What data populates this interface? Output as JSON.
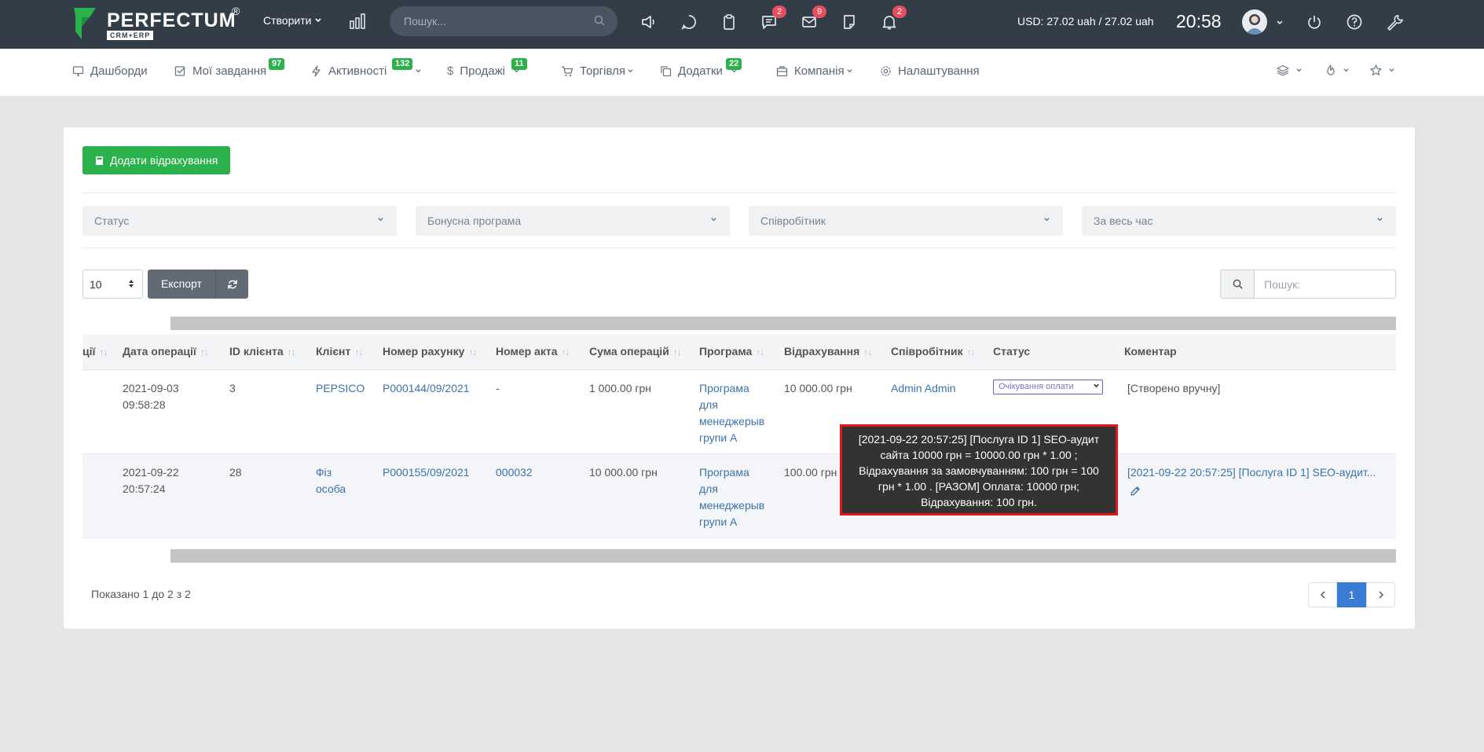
{
  "brand": {
    "name": "PERFECTUM",
    "sub": "CRM+ERP",
    "reg": "®"
  },
  "topbar": {
    "create_label": "Створити",
    "search_placeholder": "Пошук...",
    "badges": {
      "chat": "2",
      "mail": "9",
      "notifications": "2"
    },
    "currency": "USD: 27.02 uah / 27.02 uah",
    "time": "20:58"
  },
  "nav": {
    "items": [
      {
        "label": "Дашборди"
      },
      {
        "label": "Мої завдання",
        "badge": "97"
      },
      {
        "label": "Активності",
        "badge": "132"
      },
      {
        "label": "Продажі",
        "badge": "11"
      },
      {
        "label": "Торгівля"
      },
      {
        "label": "Додатки",
        "badge": "22"
      },
      {
        "label": "Компанія"
      },
      {
        "label": "Налаштування"
      }
    ]
  },
  "page": {
    "add_button": "Додати відрахування",
    "filters": [
      "Статус",
      "Бонусна програма",
      "Співробітник",
      "За весь час"
    ],
    "page_length": "10",
    "export_label": "Експорт",
    "search_placeholder": "Пошук:"
  },
  "table": {
    "columns": [
      "ції",
      "Дата операції",
      "ID клієнта",
      "Клієнт",
      "Номер рахунку",
      "Номер акта",
      "Сума операцій",
      "Програма",
      "Відрахування",
      "Співробітник",
      "Статус",
      "Коментар"
    ],
    "rows": [
      {
        "date1": "2021-09-03",
        "date2": "09:58:28",
        "client_id": "3",
        "client": "PEPSICO",
        "invoice": "P000144/09/2021",
        "act": "-",
        "amount": "1 000.00 грн",
        "program": [
          "Програма",
          "для",
          "менеджерыв",
          "групи А"
        ],
        "deduction": "10 000.00 грн",
        "employee": "Admin Admin",
        "status": "Очікування оплати",
        "comment": "[Створено вручну]"
      },
      {
        "date1": "2021-09-22",
        "date2": "20:57:24",
        "client_id": "28",
        "client": "Фіз особа",
        "invoice": "P000155/09/2021",
        "act": "000032",
        "amount": "10 000.00 грн",
        "program": [
          "Програма",
          "для",
          "менеджерыв",
          "групи А"
        ],
        "deduction": "100.00 грн",
        "comment": "[2021-09-22 20:57:25] [Послуга ID 1] SEO-аудит..."
      }
    ]
  },
  "tooltip": {
    "lines": [
      "[2021-09-22 20:57:25] [Послуга ID 1] SEO-аудит",
      "сайта 10000 грн = 10000.00 грн * 1.00 ;",
      "Відрахування за замовчуванням: 100 грн = 100",
      "грн * 1.00 . [РАЗОМ] Оплата: 10000 грн;",
      "Відрахування: 100 грн."
    ]
  },
  "footer": {
    "info": "Показано 1 до 2 з 2",
    "current_page": "1"
  },
  "colors": {
    "topbar": "#323d48",
    "accent_green": "#2bb24c",
    "badge_red": "#e54e5e",
    "pager_active": "#3a7cd5",
    "tooltip_border": "#e4141c"
  }
}
